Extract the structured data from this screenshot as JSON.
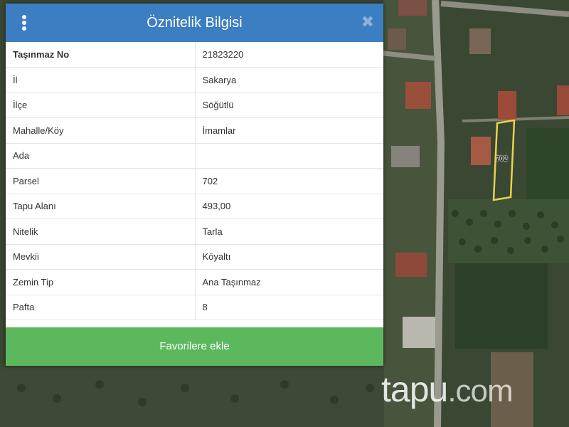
{
  "panel": {
    "title": "Öznitelik Bilgisi",
    "close_glyph": "✖",
    "rows": [
      {
        "key": "Taşınmaz No",
        "value": "21823220"
      },
      {
        "key": "İl",
        "value": "Sakarya"
      },
      {
        "key": "İlçe",
        "value": "Söğütlü"
      },
      {
        "key": "Mahalle/Köy",
        "value": "İmamlar"
      },
      {
        "key": "Ada",
        "value": ""
      },
      {
        "key": "Parsel",
        "value": "702"
      },
      {
        "key": "Tapu Alanı",
        "value": "493,00"
      },
      {
        "key": "Nitelik",
        "value": "Tarla"
      },
      {
        "key": "Mevkii",
        "value": "Köyaltı"
      },
      {
        "key": "Zemin Tip",
        "value": "Ana Taşınmaz"
      },
      {
        "key": "Pafta",
        "value": "8"
      }
    ],
    "favorite_button": "Favorilere ekle"
  },
  "map": {
    "parcel_label": "702",
    "watermark_brand": "tapu",
    "watermark_suffix": ".com"
  },
  "icons": {
    "menu": "vertical-dots-icon",
    "close": "close-icon"
  },
  "colors": {
    "header": "#3b7ec1",
    "button": "#5cb85c",
    "parcel_outline": "#e8d44a"
  }
}
